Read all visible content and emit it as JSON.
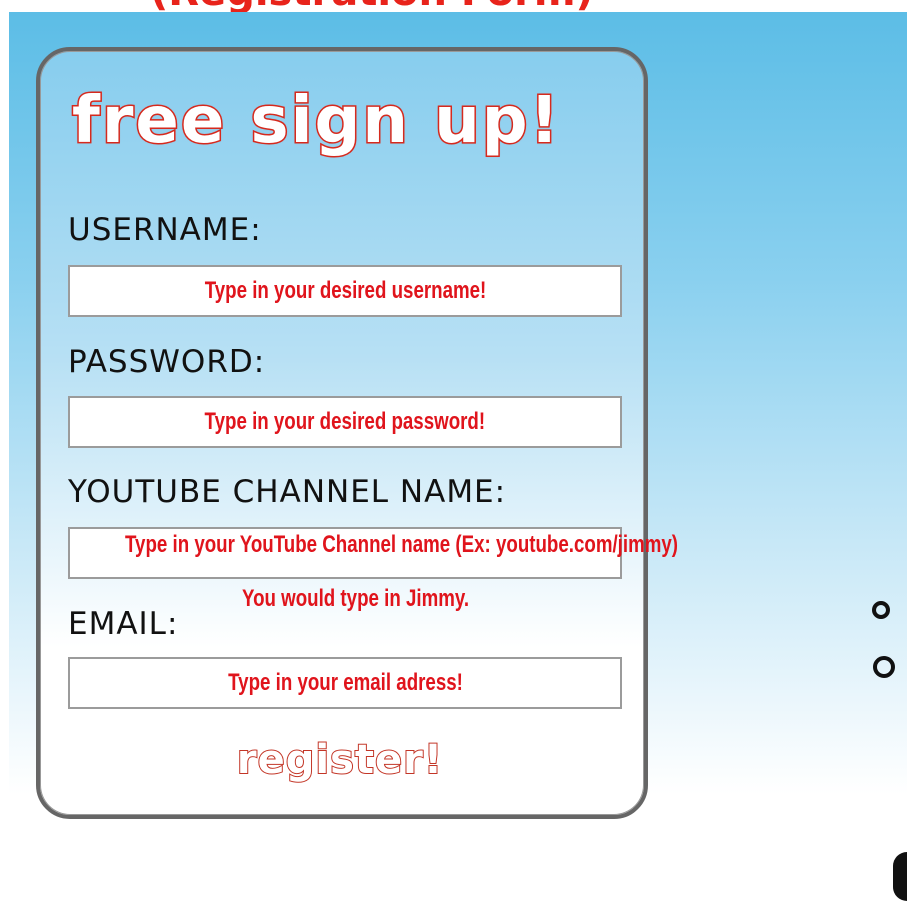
{
  "header": {
    "caption": "(Registration Form)"
  },
  "form": {
    "title": "free sign up!",
    "fields": [
      {
        "label": "USERNAME:",
        "placeholder": "Type in your desired username!"
      },
      {
        "label": "PASSWORD:",
        "placeholder": "Type in your desired password!"
      },
      {
        "label": "YOUTUBE CHANNEL NAME:",
        "placeholder": "Type in your YouTube Channel name (Ex: youtube.com/jimmy)"
      },
      {
        "label": "EMAIL:",
        "placeholder": "Type in your email adress!"
      }
    ],
    "channel_note": "You would type in Jimmy.",
    "register_label": "register!"
  },
  "colors": {
    "accent": "#e0141c",
    "title_outline": "#d62a1e",
    "panel_border": "#666666"
  }
}
